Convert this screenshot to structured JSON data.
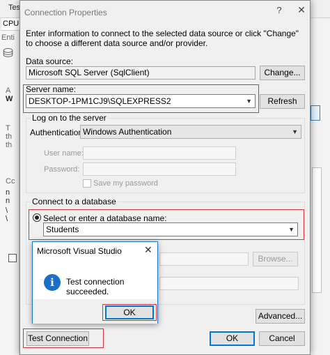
{
  "background": {
    "window_title_fragment": "Tes",
    "toolbar_fragment": "CPU",
    "left_fragments": [
      "Enti",
      "A",
      "W",
      "T",
      "th",
      "th",
      "Cc",
      "n",
      "n",
      "\\",
      "\\"
    ]
  },
  "dialog": {
    "title": "Connection Properties",
    "help_glyph": "?",
    "close_glyph": "✕",
    "intro": "Enter information to connect to the selected data source or click \"Change\" to choose a different data source and/or provider.",
    "data_source": {
      "label": "Data source:",
      "value": "Microsoft SQL Server (SqlClient)",
      "change_button": "Change..."
    },
    "server_name": {
      "label": "Server name:",
      "value": "DESKTOP-1PM1CJ9\\SQLEXPRESS2",
      "refresh_button": "Refresh"
    },
    "logon": {
      "group_title": "Log on to the server",
      "auth_label": "Authentication:",
      "auth_value": "Windows Authentication",
      "username_label": "User name:",
      "password_label": "Password:",
      "save_password_label": "Save my password"
    },
    "database": {
      "group_title": "Connect to a database",
      "select_radio_label": "Select or enter a database name:",
      "database_value": "Students",
      "browse_button": "Browse..."
    },
    "advanced_button": "Advanced...",
    "test_connection_button": "Test Connection",
    "ok_button": "OK",
    "cancel_button": "Cancel"
  },
  "message_box": {
    "title": "Microsoft Visual Studio",
    "close_glyph": "✕",
    "icon": "info-icon",
    "icon_glyph": "i",
    "text": "Test connection succeeded.",
    "ok_button": "OK"
  }
}
